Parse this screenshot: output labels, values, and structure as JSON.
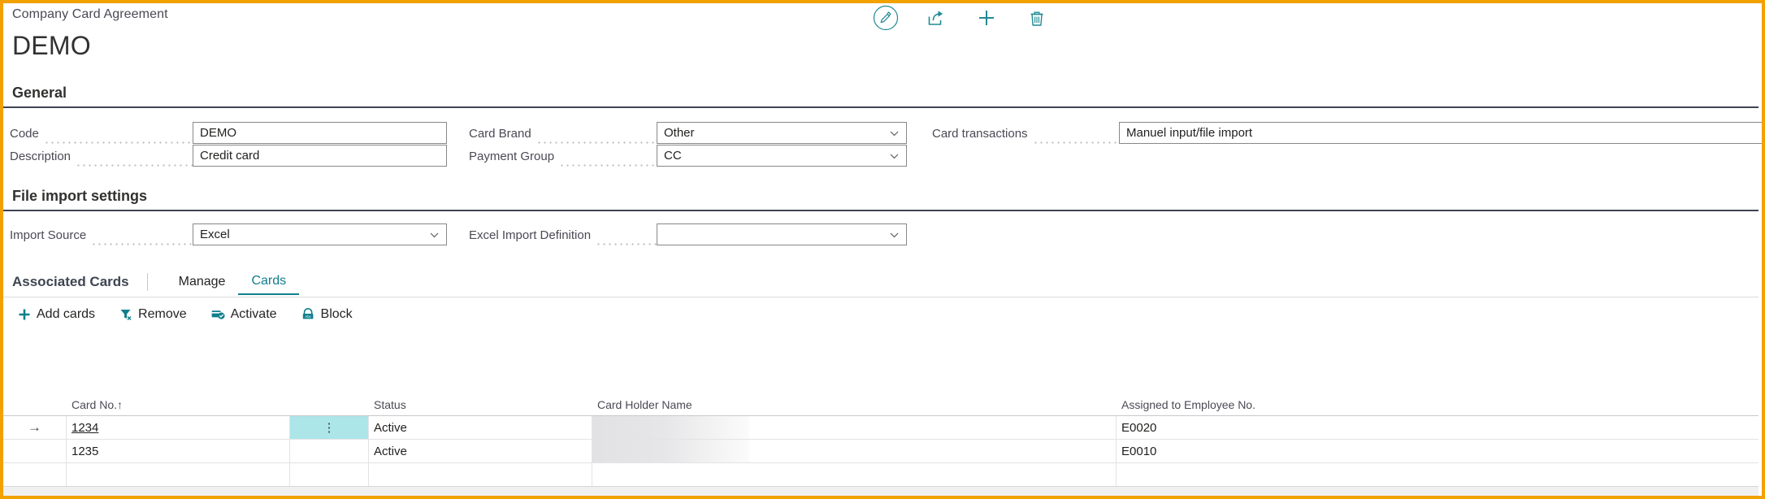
{
  "window": {
    "breadcrumb": "Company Card Agreement",
    "title": "DEMO",
    "accent_orange": "#F2A100",
    "accent_teal": "#0f7f8c",
    "selection_cyan": "#ACE6E8"
  },
  "header_actions": [
    {
      "name": "edit-icon",
      "label": "Edit"
    },
    {
      "name": "share-icon",
      "label": "Share"
    },
    {
      "name": "plus-icon",
      "label": "New"
    },
    {
      "name": "trash-icon",
      "label": "Delete"
    }
  ],
  "general": {
    "title": "General",
    "fields": [
      {
        "label": "Code",
        "value": "DEMO",
        "type": "text"
      },
      {
        "label": "Description",
        "value": "Credit card",
        "type": "text"
      },
      {
        "label": "Card Brand",
        "value": "Other",
        "type": "select"
      },
      {
        "label": "Payment Group",
        "value": "CC",
        "type": "select"
      },
      {
        "label": "Card transactions",
        "value": "Manuel input/file import",
        "type": "text"
      }
    ]
  },
  "file_import": {
    "title": "File import settings",
    "fields": [
      {
        "label": "Import Source",
        "value": "Excel",
        "type": "select"
      },
      {
        "label": "Excel Import Definition",
        "value": "",
        "type": "select"
      }
    ]
  },
  "associated_cards": {
    "title": "Associated Cards",
    "tabs": [
      {
        "label": "Manage",
        "active": false
      },
      {
        "label": "Cards",
        "active": true
      }
    ],
    "actions": [
      {
        "label": "Add cards",
        "icon": "plus-icon"
      },
      {
        "label": "Remove",
        "icon": "filter-remove-icon"
      },
      {
        "label": "Activate",
        "icon": "activate-card-icon"
      },
      {
        "label": "Block",
        "icon": "block-card-icon"
      }
    ],
    "columns": [
      {
        "label": "Card No.",
        "sort": "↑"
      },
      {
        "label": "Status",
        "sort": ""
      },
      {
        "label": "Card Holder Name",
        "sort": ""
      },
      {
        "label": "Assigned to Employee No.",
        "sort": ""
      }
    ],
    "rows": [
      {
        "selected": true,
        "arrow": "→",
        "card_no": "1234",
        "menu": "⋮",
        "status": "Active",
        "card_holder_name": "",
        "employee_no": "E0020"
      },
      {
        "selected": false,
        "arrow": "",
        "card_no": "1235",
        "menu": "",
        "status": "Active",
        "card_holder_name": "",
        "employee_no": "E0010"
      },
      {
        "selected": false,
        "arrow": "",
        "card_no": "",
        "menu": "",
        "status": "",
        "card_holder_name": "",
        "employee_no": ""
      }
    ]
  }
}
